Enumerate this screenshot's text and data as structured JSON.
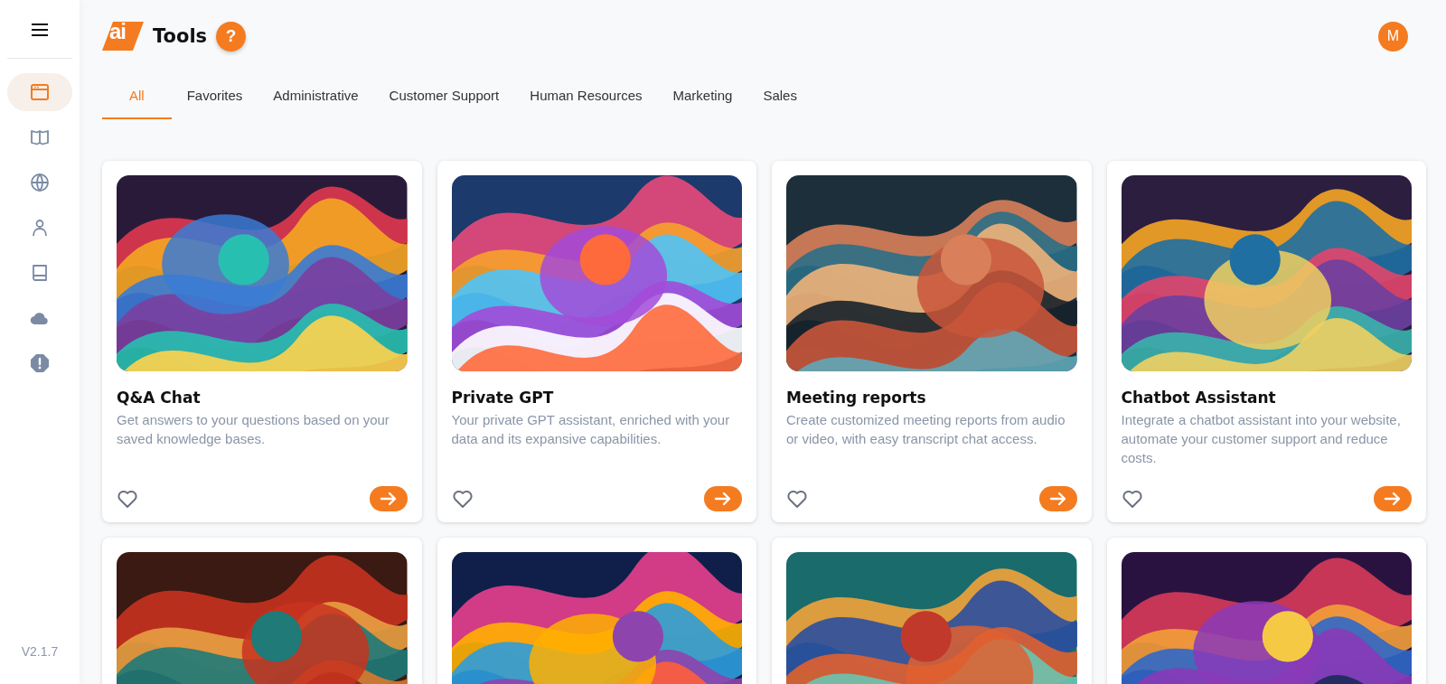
{
  "sidebar": {
    "items": [
      {
        "selected": true
      },
      {
        "selected": false
      },
      {
        "selected": false
      },
      {
        "selected": false
      },
      {
        "selected": false
      },
      {
        "selected": false
      },
      {
        "selected": false
      }
    ],
    "version": "V2.1.7"
  },
  "header": {
    "logo_text": "ai",
    "title": "Tools",
    "help": "?",
    "avatar": "M"
  },
  "tabs": [
    {
      "label": "All",
      "selected": true
    },
    {
      "label": "Favorites",
      "selected": false
    },
    {
      "label": "Administrative",
      "selected": false
    },
    {
      "label": "Customer Support",
      "selected": false
    },
    {
      "label": "Human Resources",
      "selected": false
    },
    {
      "label": "Marketing",
      "selected": false
    },
    {
      "label": "Sales",
      "selected": false
    }
  ],
  "cards": [
    {
      "image": {
        "kind": "picture"
      },
      "title": "Q&A Chat",
      "description": "Get answers to your questions based on your saved knowledge bases.",
      "favorite": false
    },
    {
      "image": {
        "kind": "picture"
      },
      "title": "Private GPT",
      "description": "Your private GPT assistant, enriched with your data and its expansive capabilities.",
      "favorite": false
    },
    {
      "image": {
        "kind": "picture"
      },
      "title": "Meeting reports",
      "description": "Create customized meeting reports from audio or video, with easy transcript chat access.",
      "favorite": false
    },
    {
      "image": {
        "kind": "picture"
      },
      "title": "Chatbot Assistant",
      "description": "Integrate a chatbot assistant into your website, automate your customer support and reduce costs.",
      "favorite": false
    },
    {
      "image": {
        "kind": "picture"
      }
    },
    {
      "image": {
        "kind": "picture"
      }
    },
    {
      "image": {
        "kind": "picture"
      }
    },
    {
      "image": {
        "kind": "picture"
      }
    }
  ]
}
